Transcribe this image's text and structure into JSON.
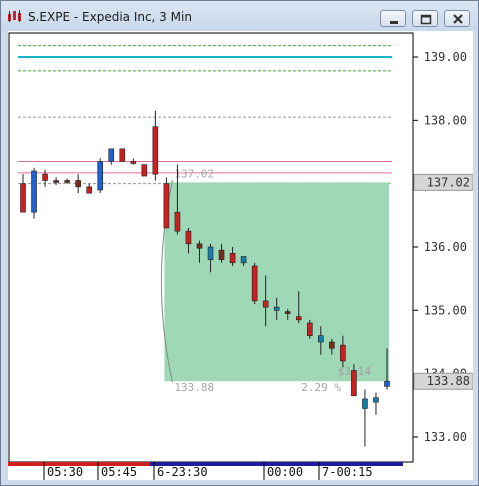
{
  "window": {
    "title": "S.EXPE - Expedia Inc, 3 Min",
    "buttons": [
      "minimize",
      "restore",
      "close"
    ]
  },
  "chart_data": {
    "type": "candlestick",
    "title": "",
    "price_axis": {
      "ticks": [
        "139.00",
        "138.00",
        "137.00",
        "136.00",
        "135.00",
        "134.00",
        "133.00"
      ],
      "range": [
        132.6,
        139.6
      ]
    },
    "time_axis": {
      "labels": [
        "05:30",
        "05:45",
        "6-23:30",
        "00:00",
        "7-00:15"
      ]
    },
    "current_price": {
      "label": "137.02",
      "value": 137.02
    },
    "last_price": {
      "label": "133.88",
      "value": 133.88
    },
    "candles": [
      {
        "o": 137.0,
        "h": 137.15,
        "l": 136.55,
        "c": 136.55,
        "color": "red"
      },
      {
        "o": 136.55,
        "h": 137.25,
        "l": 136.45,
        "c": 137.2,
        "color": "blue"
      },
      {
        "o": 137.15,
        "h": 137.22,
        "l": 136.95,
        "c": 137.05,
        "color": "red"
      },
      {
        "o": 137.05,
        "h": 137.1,
        "l": 136.98,
        "c": 137.05,
        "color": "dark"
      },
      {
        "o": 137.05,
        "h": 137.08,
        "l": 137.0,
        "c": 137.05,
        "color": "dark"
      },
      {
        "o": 137.05,
        "h": 137.15,
        "l": 136.85,
        "c": 136.95,
        "color": "dark"
      },
      {
        "o": 136.95,
        "h": 137.0,
        "l": 136.85,
        "c": 136.85,
        "color": "red"
      },
      {
        "o": 136.9,
        "h": 137.4,
        "l": 136.85,
        "c": 137.35,
        "color": "blue"
      },
      {
        "o": 137.35,
        "h": 137.55,
        "l": 137.3,
        "c": 137.55,
        "color": "blue"
      },
      {
        "o": 137.55,
        "h": 137.55,
        "l": 137.35,
        "c": 137.35,
        "color": "red"
      },
      {
        "o": 137.35,
        "h": 137.4,
        "l": 137.3,
        "c": 137.33,
        "color": "red"
      },
      {
        "o": 137.3,
        "h": 137.3,
        "l": 137.12,
        "c": 137.12,
        "color": "red"
      },
      {
        "o": 137.9,
        "h": 138.15,
        "l": 137.05,
        "c": 137.15,
        "color": "red"
      },
      {
        "o": 137.0,
        "h": 137.1,
        "l": 136.3,
        "c": 136.3,
        "color": "red"
      },
      {
        "o": 136.55,
        "h": 137.3,
        "l": 136.2,
        "c": 136.25,
        "color": "red"
      },
      {
        "o": 136.25,
        "h": 136.3,
        "l": 135.9,
        "c": 136.05,
        "color": "red"
      },
      {
        "o": 136.05,
        "h": 136.1,
        "l": 135.75,
        "c": 135.98,
        "color": "dark"
      },
      {
        "o": 135.8,
        "h": 136.05,
        "l": 135.6,
        "c": 136.0,
        "color": "teal"
      },
      {
        "o": 135.95,
        "h": 136.05,
        "l": 135.75,
        "c": 135.8,
        "color": "dark"
      },
      {
        "o": 135.9,
        "h": 136.0,
        "l": 135.7,
        "c": 135.75,
        "color": "red"
      },
      {
        "o": 135.75,
        "h": 135.85,
        "l": 135.7,
        "c": 135.85,
        "color": "teal"
      },
      {
        "o": 135.7,
        "h": 135.75,
        "l": 135.1,
        "c": 135.15,
        "color": "red"
      },
      {
        "o": 135.15,
        "h": 135.55,
        "l": 134.75,
        "c": 135.05,
        "color": "red"
      },
      {
        "o": 135.05,
        "h": 135.2,
        "l": 134.85,
        "c": 135.0,
        "color": "teal"
      },
      {
        "o": 134.98,
        "h": 135.02,
        "l": 134.85,
        "c": 134.95,
        "color": "dark"
      },
      {
        "o": 134.85,
        "h": 135.3,
        "l": 134.8,
        "c": 134.9,
        "color": "red"
      },
      {
        "o": 134.8,
        "h": 134.85,
        "l": 134.55,
        "c": 134.6,
        "color": "red"
      },
      {
        "o": 134.5,
        "h": 134.75,
        "l": 134.3,
        "c": 134.6,
        "color": "teal"
      },
      {
        "o": 134.5,
        "h": 134.55,
        "l": 134.3,
        "c": 134.4,
        "color": "dark"
      },
      {
        "o": 134.45,
        "h": 134.6,
        "l": 134.1,
        "c": 134.2,
        "color": "red"
      },
      {
        "o": 134.05,
        "h": 134.15,
        "l": 133.65,
        "c": 133.65,
        "color": "red"
      },
      {
        "o": 133.6,
        "h": 133.75,
        "l": 132.85,
        "c": 133.45,
        "color": "teal"
      },
      {
        "o": 133.55,
        "h": 133.7,
        "l": 133.35,
        "c": 133.62,
        "color": "teal"
      },
      {
        "o": 133.8,
        "h": 134.4,
        "l": 133.75,
        "c": 133.88,
        "color": "blue"
      }
    ],
    "levels": [
      {
        "price": 139.18,
        "color": "#3caa3c",
        "style": "dashed"
      },
      {
        "price": 139.0,
        "color": "#19b3c8",
        "style": "solid"
      },
      {
        "price": 138.78,
        "color": "#3caa3c",
        "style": "dashed"
      },
      {
        "price": 138.05,
        "color": "#999999",
        "style": "dashed"
      },
      {
        "price": 137.35,
        "color": "#e06fa0",
        "style": "solid"
      },
      {
        "price": 137.17,
        "color": "#e06fa0",
        "style": "solid"
      },
      {
        "price": 137.0,
        "color": "#999999",
        "style": "dashed"
      }
    ],
    "trade": {
      "entry_label": "137.02",
      "exit_label": "133.88",
      "entry": 137.02,
      "exit": 133.88,
      "profit_label": "$3.14",
      "pct_label": "2.29 %",
      "fill_color": "#99d6b2"
    }
  }
}
